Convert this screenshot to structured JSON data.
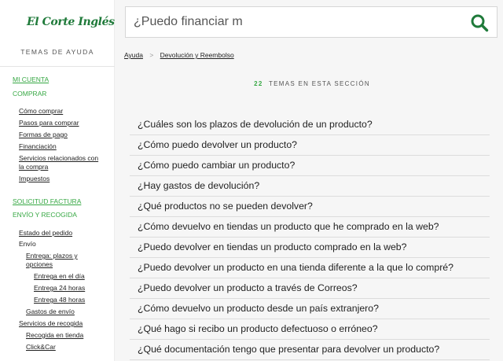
{
  "brand": {
    "name": "El Corte Inglés",
    "color": "#1f7a3a",
    "accent": "#37a844"
  },
  "sidebar": {
    "title": "TEMAS DE AYUDA",
    "items": [
      {
        "label": "MI CUENTA",
        "type": "category",
        "active": true
      },
      {
        "label": "COMPRAR",
        "type": "category"
      },
      {
        "label": "Cómo comprar",
        "type": "link"
      },
      {
        "label": "Pasos para comprar",
        "type": "link"
      },
      {
        "label": "Formas de pago",
        "type": "link"
      },
      {
        "label": "Financiación",
        "type": "link"
      },
      {
        "label": "Servicios relacionados con la compra",
        "type": "link"
      },
      {
        "label": "Impuestos",
        "type": "link"
      },
      {
        "label": "SOLICITUD FACTURA",
        "type": "category",
        "active": true
      },
      {
        "label": "ENVÍO Y RECOGIDA",
        "type": "category"
      },
      {
        "label": "Estado del pedido",
        "type": "link"
      },
      {
        "label": "Envío",
        "type": "plain"
      },
      {
        "label": "Entrega: plazos y opciones",
        "type": "link"
      },
      {
        "label": "Entrega en el día",
        "type": "link"
      },
      {
        "label": "Entrega 24 horas",
        "type": "link"
      },
      {
        "label": "Entrega 48 horas",
        "type": "link"
      },
      {
        "label": "Gastos de envío",
        "type": "link"
      },
      {
        "label": "Servicios de recogida",
        "type": "link"
      },
      {
        "label": "Recogida en tienda",
        "type": "link"
      },
      {
        "label": "Click&Car",
        "type": "link"
      }
    ]
  },
  "search": {
    "value": "¿Puedo financiar m",
    "icon": "search-icon"
  },
  "breadcrumb": {
    "home": "Ayuda",
    "separator": ">",
    "current": "Devolución y Reembolso"
  },
  "topics": {
    "count": "22",
    "label": "TEMAS EN ESTA SECCIÓN"
  },
  "questions": [
    "¿Cuáles son los plazos de devolución de un producto?",
    "¿Cómo puedo devolver un producto?",
    "¿Cómo puedo cambiar un producto?",
    "¿Hay gastos de devolución?",
    "¿Qué productos no se pueden devolver?",
    "¿Cómo devuelvo en tiendas un producto que he comprado en la web?",
    "¿Puedo devolver en tiendas un producto comprado en la web?",
    "¿Puedo devolver un producto en una tienda diferente a la que lo compré?",
    "¿Puedo devolver un producto a través de Correos?",
    "¿Cómo devuelvo un producto desde un país extranjero?",
    "¿Qué hago si recibo un producto defectuoso o erróneo?",
    "¿Qué documentación tengo que presentar para devolver un producto?"
  ]
}
